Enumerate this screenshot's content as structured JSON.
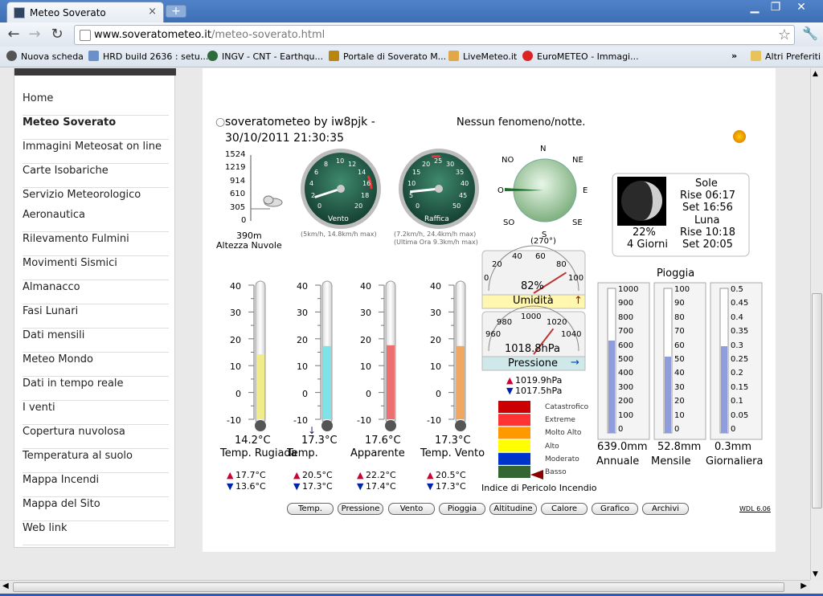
{
  "browser": {
    "tab_title": "Meteo Soverato",
    "url_host": "www.soveratometeo.it",
    "url_path": "/meteo-soverato.html",
    "bookmarks": [
      "Nuova scheda",
      "HRD build 2636 : setu...",
      "INGV - CNT - Earthqu...",
      "Portale di Soverato M...",
      "LiveMeteo.it",
      "EuroMETEO - Immagi..."
    ],
    "bookmarks_more": "»",
    "other_bookmarks": "Altri Preferiti",
    "colors": {
      "titlebar": "#3d6fb5",
      "accent": "#4f82c8"
    }
  },
  "sidebar": {
    "items": [
      {
        "label": "Home"
      },
      {
        "label": "Meteo Soverato"
      },
      {
        "label": "Immagini Meteosat on line"
      },
      {
        "label": "Carte Isobariche"
      },
      {
        "label": "Servizio Meteorologico"
      },
      {
        "label": "Aeronautica"
      },
      {
        "label": "Rilevamento Fulmini"
      },
      {
        "label": "Movimenti Sismici"
      },
      {
        "label": "Almanacco"
      },
      {
        "label": "Fasi Lunari"
      },
      {
        "label": "Dati mensili"
      },
      {
        "label": "Meteo Mondo"
      },
      {
        "label": "Dati in tempo reale"
      },
      {
        "label": "I venti"
      },
      {
        "label": "Copertura nuvolosa"
      },
      {
        "label": "Temperatura al suolo"
      },
      {
        "label": "Mappa Incendi"
      },
      {
        "label": "Mappa del Sito"
      },
      {
        "label": "Web link"
      }
    ]
  },
  "station": {
    "header_line1": "soveratometeo by iw8pjk -",
    "header_line2": "30/10/2011 21:30:35",
    "condition": "Nessun fenomeno/notte."
  },
  "cloud": {
    "ticks": [
      "1524",
      "1219",
      "914",
      "610",
      "305",
      "0"
    ],
    "value": "390m",
    "label": "Altezza Nuvole"
  },
  "wind": {
    "ticks": [
      "0",
      "2",
      "4",
      "6",
      "8",
      "10",
      "12",
      "14",
      "16",
      "18",
      "20"
    ],
    "speed_kmh": 2,
    "label": "Vento",
    "note": "(5km/h, 14.8km/h max)"
  },
  "gust": {
    "ticks": [
      "0",
      "5",
      "10",
      "15",
      "20",
      "25",
      "30",
      "35",
      "40",
      "45",
      "50"
    ],
    "speed_kmh": 7.2,
    "label": "Raffica",
    "note1": "(7.2km/h, 24.4km/h max)",
    "note2": "(Ultima Ora 9.3km/h max)"
  },
  "compass": {
    "n": "N",
    "ne": "NE",
    "e": "E",
    "se": "SE",
    "s": "S",
    "so": "SO",
    "o": "O",
    "no": "NO",
    "bearing": "(270°)",
    "direction_deg": 270
  },
  "almanac": {
    "sun": "Sole",
    "sunrise": "Rise 06:17",
    "sunset": "Set 16:56",
    "moon": "Luna",
    "moonrise": "Rise 10:18",
    "moonset": "Set 20:05",
    "moon_pct": "22%",
    "moon_age": "4 Giorni"
  },
  "humidity": {
    "ticks": [
      "0",
      "20",
      "40",
      "60",
      "80",
      "100"
    ],
    "value": "82%",
    "percent": 82,
    "label": "Umidità",
    "trend": "↑"
  },
  "pressure": {
    "ticks": [
      "960",
      "980",
      "1000",
      "1020",
      "1040"
    ],
    "value": "1018.8hPa",
    "hpa": 1018.8,
    "label": "Pressione",
    "trend": "→",
    "max": "1019.9hPa",
    "min": "1017.5hPa"
  },
  "thermometers": [
    {
      "value": "14.2°C",
      "label": "Temp. Rugiada",
      "max": "17.7°C",
      "min": "13.6°C",
      "level": 14.2,
      "color": "#f0ec8a"
    },
    {
      "value": "17.3°C",
      "label": "Temp.",
      "max": "20.5°C",
      "min": "17.3°C",
      "level": 17.3,
      "color": "#7de3e8"
    },
    {
      "value": "17.6°C",
      "label": "Apparente",
      "max": "22.2°C",
      "min": "17.4°C",
      "level": 17.6,
      "color": "#ee6f6f"
    },
    {
      "value": "17.3°C",
      "label": "Temp. Vento",
      "max": "20.5°C",
      "min": "17.3°C",
      "level": 17.3,
      "color": "#f0a860"
    }
  ],
  "thermo_ticks": [
    "40",
    "30",
    "20",
    "10",
    "0",
    "-10"
  ],
  "fire": {
    "levels": [
      "Catastrofico",
      "Extreme",
      "Molto Alto",
      "Alto",
      "Moderato",
      "Basso"
    ],
    "colors": [
      "#cc0000",
      "#ff3333",
      "#ff9900",
      "#ffff00",
      "#0033cc",
      "#336633"
    ],
    "label": "Indice di Pericolo Incendio"
  },
  "rain": {
    "title": "Pioggia",
    "gauges": [
      {
        "value": "639.0mm",
        "label": "Annuale",
        "ticks": [
          "1000",
          "900",
          "800",
          "700",
          "600",
          "500",
          "400",
          "300",
          "200",
          "100",
          "0"
        ],
        "fill": 0.639
      },
      {
        "value": "52.8mm",
        "label": "Mensile",
        "ticks": [
          "100",
          "90",
          "80",
          "70",
          "60",
          "50",
          "40",
          "30",
          "20",
          "10",
          "0"
        ],
        "fill": 0.528
      },
      {
        "value": "0.3mm",
        "label": "Giornaliera",
        "ticks": [
          "0.5",
          "0.45",
          "0.4",
          "0.35",
          "0.3",
          "0.25",
          "0.2",
          "0.15",
          "0.1",
          "0.05",
          "0"
        ],
        "fill": 0.6
      }
    ]
  },
  "nav_buttons": [
    "Temp.",
    "Pressione",
    "Vento",
    "Pioggia",
    "Altitudine",
    "Calore",
    "Grafico",
    "Archivi"
  ],
  "version": "WDL 6.06"
}
